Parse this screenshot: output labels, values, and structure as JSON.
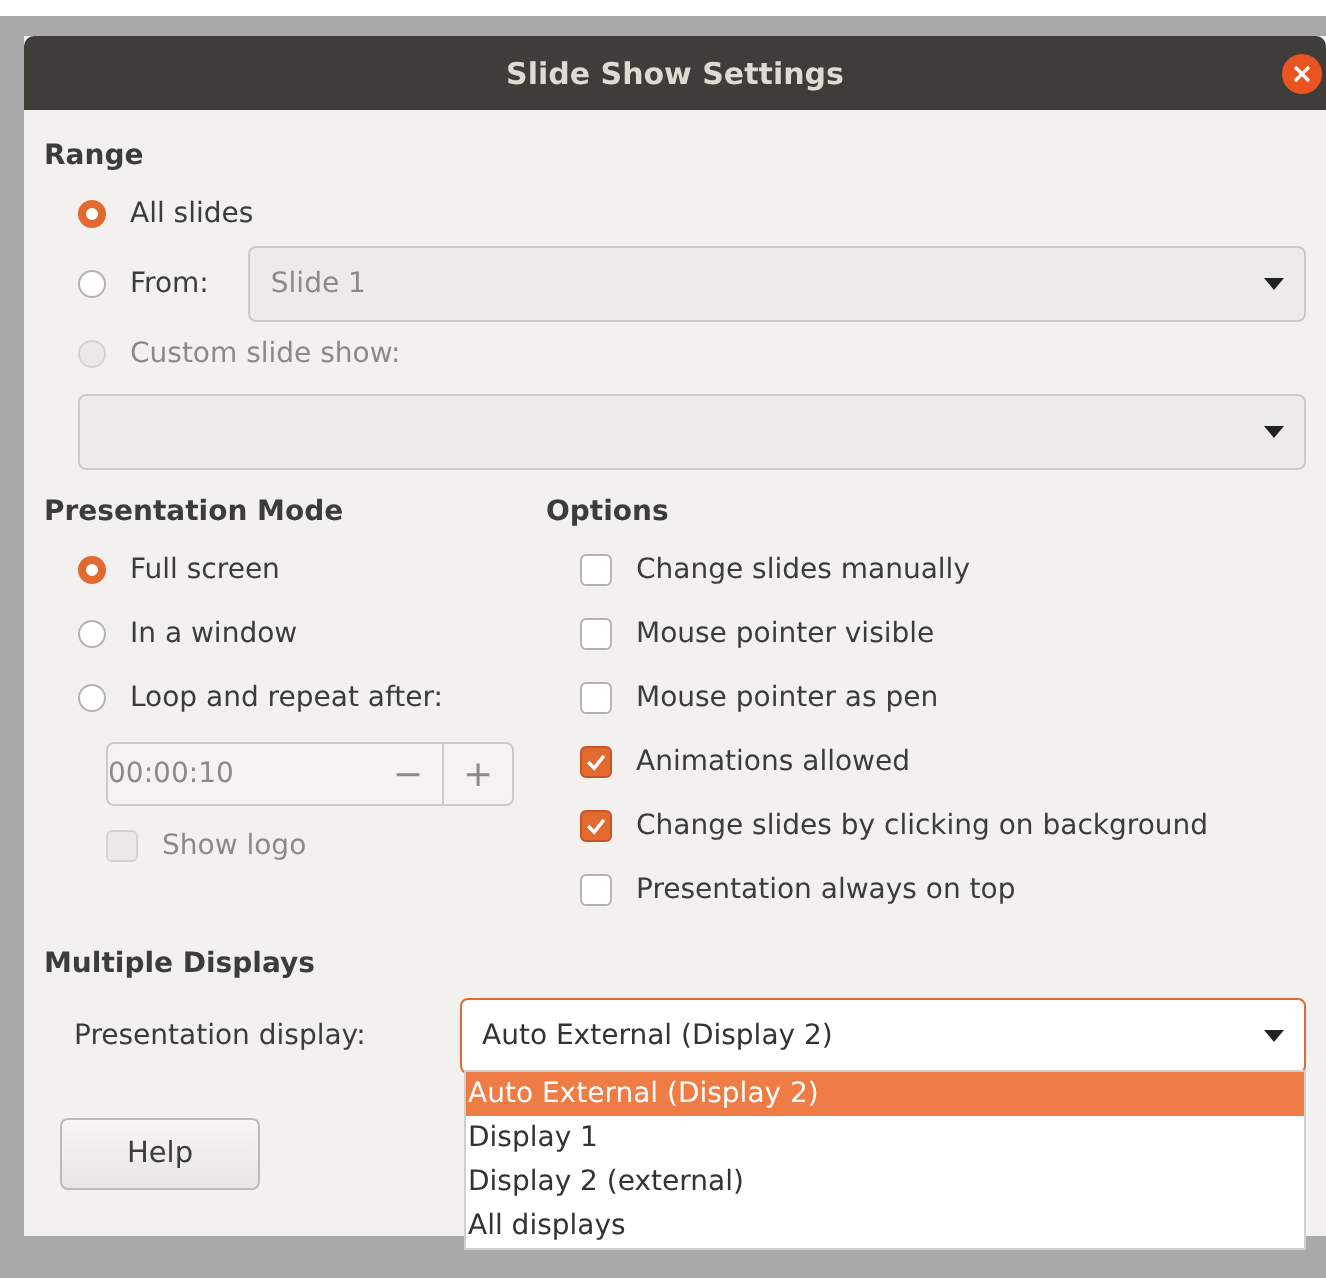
{
  "window": {
    "title": "Slide Show Settings"
  },
  "range": {
    "heading": "Range",
    "options": [
      {
        "label": "All slides",
        "selected": true,
        "disabled": false
      },
      {
        "label": "From:",
        "selected": false,
        "disabled": false
      },
      {
        "label": "Custom slide show:",
        "selected": false,
        "disabled": true
      }
    ],
    "from_select": {
      "value": "Slide 1"
    }
  },
  "presentation_mode": {
    "heading": "Presentation Mode",
    "options": [
      {
        "label": "Full screen",
        "selected": true
      },
      {
        "label": "In a window",
        "selected": false
      },
      {
        "label": "Loop and repeat after:",
        "selected": false
      }
    ],
    "loop_time": {
      "value": "00:00:10",
      "minus": "−",
      "plus": "+"
    },
    "show_logo": {
      "label": "Show logo",
      "checked": false,
      "disabled": true
    }
  },
  "options": {
    "heading": "Options",
    "items": [
      {
        "label": "Change slides manually",
        "checked": false
      },
      {
        "label": "Mouse pointer visible",
        "checked": false
      },
      {
        "label": "Mouse pointer as pen",
        "checked": false
      },
      {
        "label": "Animations allowed",
        "checked": true
      },
      {
        "label": "Change slides by clicking on background",
        "checked": true
      },
      {
        "label": "Presentation always on top",
        "checked": false
      }
    ]
  },
  "multiple_displays": {
    "heading": "Multiple Displays",
    "label": "Presentation display:",
    "value": "Auto External (Display 2)",
    "dropdown": [
      {
        "label": "Auto External (Display 2)",
        "selected": true
      },
      {
        "label": "Display 1",
        "selected": false
      },
      {
        "label": "Display 2 (external)",
        "selected": false
      },
      {
        "label": "All displays",
        "selected": false
      }
    ]
  },
  "buttons": [
    "Help"
  ]
}
